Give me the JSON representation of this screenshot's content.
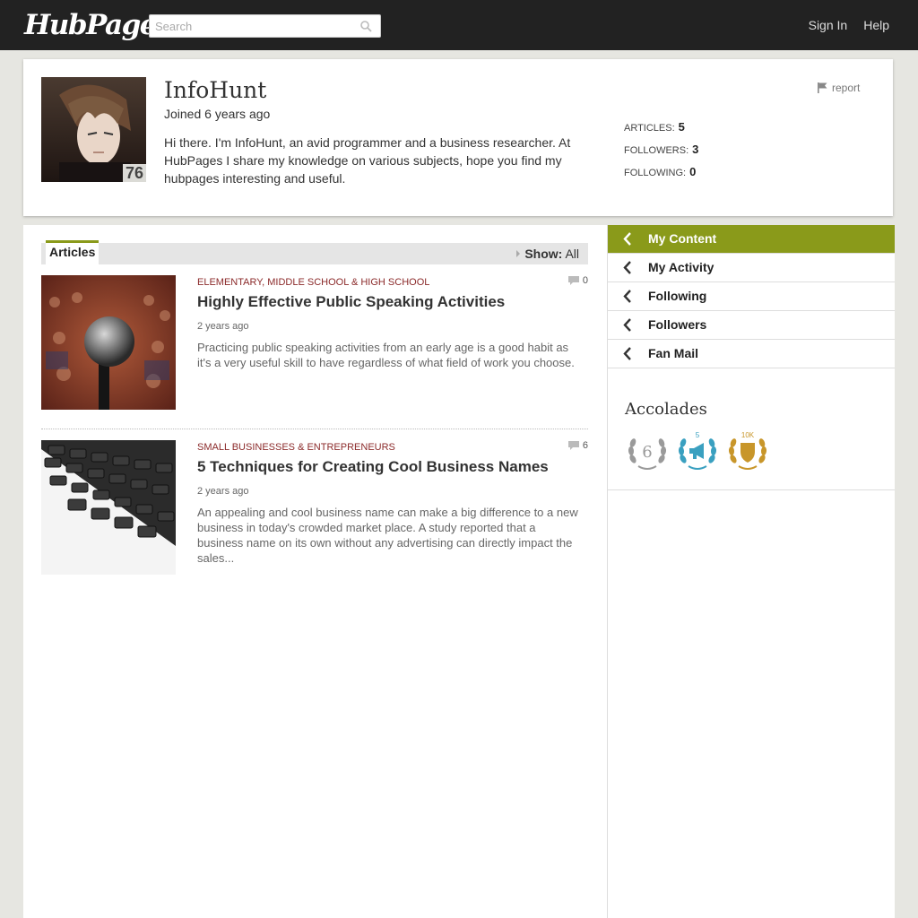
{
  "header": {
    "logo": "HubPages",
    "logo_mark": "®",
    "search_placeholder": "Search",
    "sign_in": "Sign In",
    "help": "Help"
  },
  "profile": {
    "name": "InfoHunt",
    "joined": "Joined 6 years ago",
    "bio": "Hi there. I'm InfoHunt, an avid programmer and a business researcher. At HubPages I share my knowledge on various subjects, hope you find my hubpages interesting and useful.",
    "hubscore": "76",
    "report": "report",
    "stats": [
      {
        "label": "ARTICLES:",
        "value": "5"
      },
      {
        "label": "FOLLOWERS:",
        "value": "3"
      },
      {
        "label": "FOLLOWING:",
        "value": "0"
      }
    ]
  },
  "articles_section": {
    "tab": "Articles",
    "show_label": "Show:",
    "show_value": "All"
  },
  "articles": [
    {
      "category": "Elementary, Middle School & High School",
      "title": "Highly Effective Public Speaking Activities",
      "date": "2 years ago",
      "excerpt": "Practicing public speaking activities from an early age is a good habit as it's a very useful skill to have regardless of what field of work you choose.",
      "comments": "0"
    },
    {
      "category": "Small Businesses & Entrepreneurs",
      "title": "5 Techniques for Creating Cool Business Names",
      "date": "2 years ago",
      "excerpt": "An appealing and cool business name can make a big difference to a new business in today's crowded market place. A study reported that a business name on its own without any advertising can directly impact the sales...",
      "comments": "6"
    }
  ],
  "sidebar": {
    "nav": [
      "My Content",
      "My Activity",
      "Following",
      "Followers",
      "Fan Mail"
    ],
    "accolades_title": "Accolades",
    "badges": [
      "6",
      "5",
      "10K"
    ]
  },
  "colors": {
    "accent": "#8a9a1a",
    "topbar": "#222222",
    "category": "#8b2a2a"
  }
}
